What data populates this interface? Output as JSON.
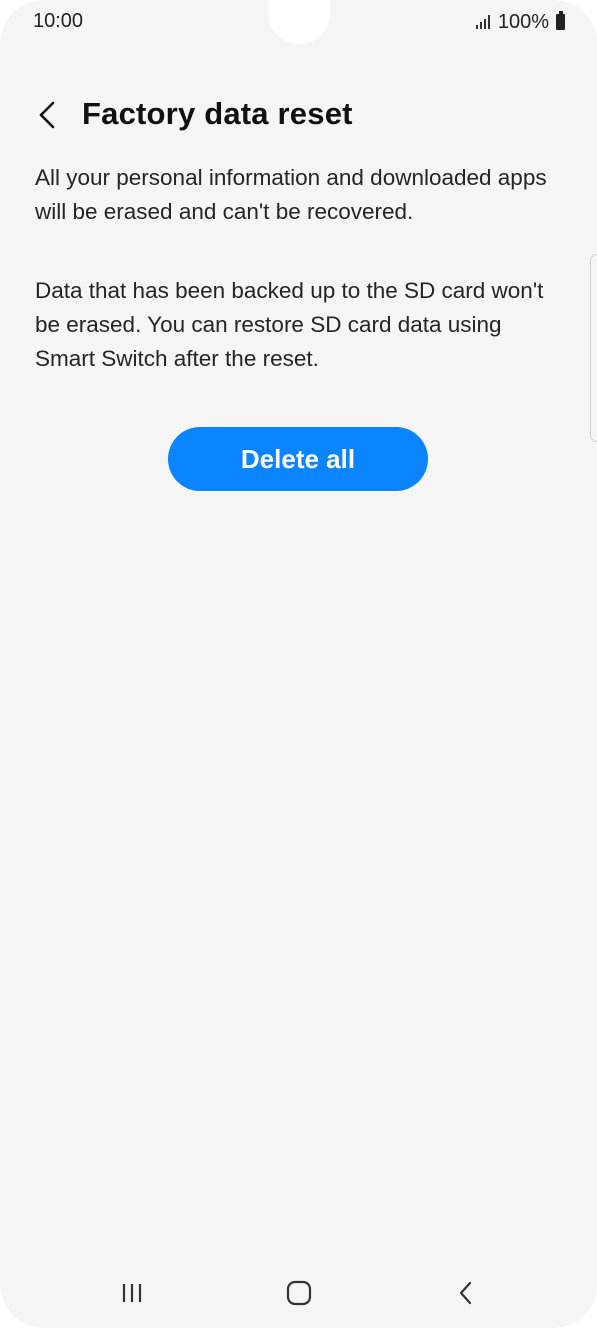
{
  "status_bar": {
    "time": "10:00",
    "battery_text": "100%",
    "icons": [
      "signal-icon",
      "battery-icon"
    ]
  },
  "header": {
    "back_icon": "chevron-left-icon",
    "title": "Factory data reset"
  },
  "content": {
    "paragraph1": "All your personal information and downloaded apps will be erased and can't be recovered.",
    "paragraph2": "Data that has been backed up to the SD card won't be erased. You can restore SD card data using Smart Switch after the reset.",
    "delete_button_label": "Delete all"
  },
  "nav_bar": {
    "buttons": [
      "recent-apps-icon",
      "home-icon",
      "back-icon"
    ]
  },
  "colors": {
    "background": "#f5f5f5",
    "accent": "#0a84ff",
    "text": "#252525"
  }
}
